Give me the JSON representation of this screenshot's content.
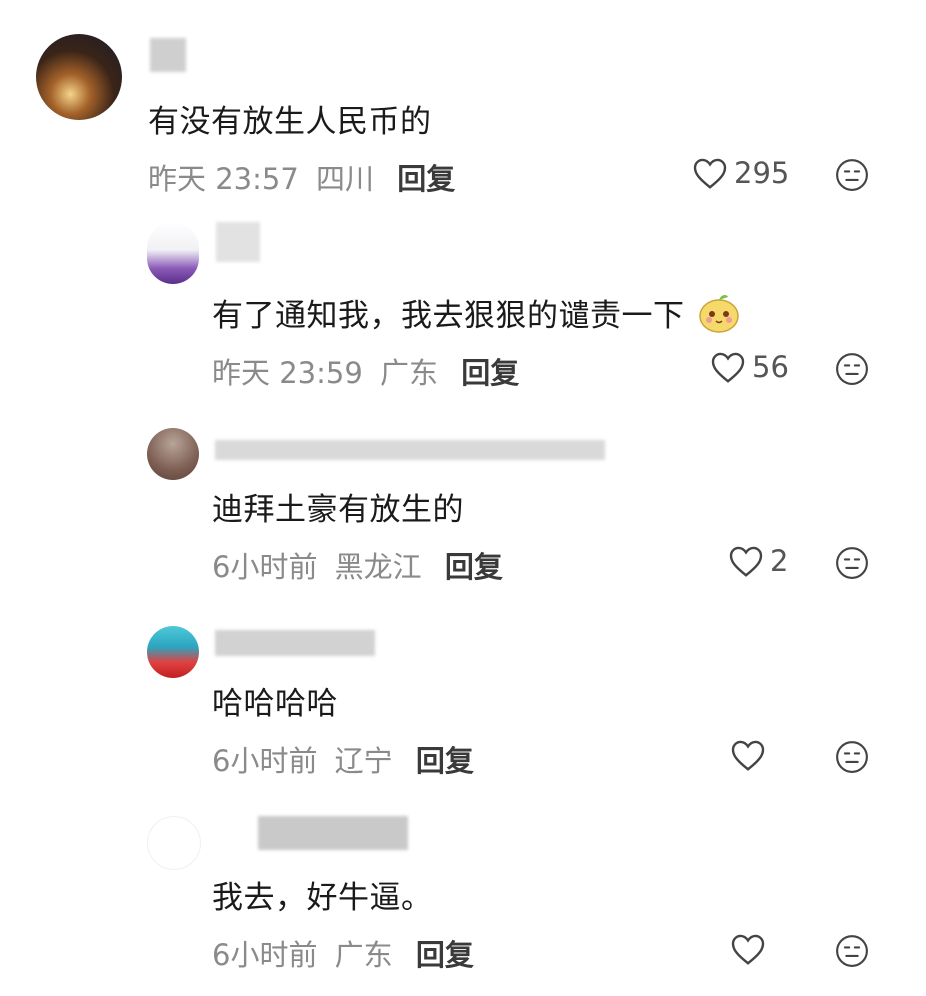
{
  "comments": [
    {
      "text": "有没有放生人民币的",
      "time": "昨天 23:57",
      "location": "四川",
      "reply_label": "回复",
      "likes": "295",
      "has_emoji": false
    },
    {
      "text": "有了通知我，我去狠狠的谴责一下",
      "time": "昨天 23:59",
      "location": "广东",
      "reply_label": "回复",
      "likes": "56",
      "has_emoji": true
    },
    {
      "text": "迪拜土豪有放生的",
      "time": "6小时前",
      "location": "黑龙江",
      "reply_label": "回复",
      "likes": "2",
      "has_emoji": false
    },
    {
      "text": "哈哈哈哈",
      "time": "6小时前",
      "location": "辽宁",
      "reply_label": "回复",
      "likes": "",
      "has_emoji": false
    },
    {
      "text": "我去，好牛逼。",
      "time": "6小时前",
      "location": "广东",
      "reply_label": "回复",
      "likes": "",
      "has_emoji": false
    }
  ],
  "colors": {
    "meta_text": "#8a8a8a",
    "reply_text": "#3a3a3a",
    "icon_stroke": "#444444"
  }
}
